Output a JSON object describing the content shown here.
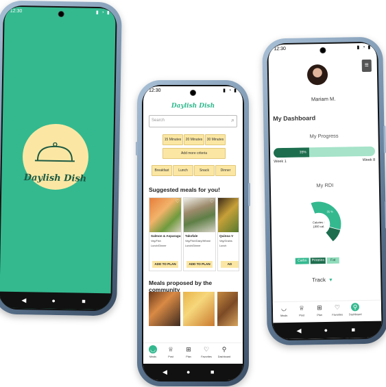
{
  "colors": {
    "brand_green": "#34b98f",
    "dark_green": "#1d6e4f",
    "light_yellow": "#fbe7a3"
  },
  "status_time": "12:30",
  "splash": {
    "logo_text": "Daylish Dish"
  },
  "home": {
    "brand": "Daylish Dish",
    "search_placeholder": "Search",
    "time_filters": [
      "15 Minutes",
      "20 Minutes",
      "30 Minutes"
    ],
    "add_criteria": "Add more criteria",
    "meal_filters": [
      "Breakfast",
      "Lunch",
      "Snack",
      "Dinner"
    ],
    "suggested_title": "Suggested meals for you!",
    "cards": [
      {
        "title": "Salmon & Asparagus",
        "tags": "Veg/Fish",
        "meals": "Lunch/Dinner",
        "action": "ADD TO PLAN"
      },
      {
        "title": "Takofale",
        "tags": "Veg/Fish/Dairy/Wheat",
        "meals": "Lunch/Dinner",
        "action": "ADD TO PLAN"
      },
      {
        "title": "Quinoa V",
        "tags": "Veg/Grains",
        "meals": "Lunch",
        "action": "AD"
      }
    ],
    "community_title": "Meals proposed by the community",
    "nav": [
      {
        "label": "Meals",
        "icon": "bowl-icon"
      },
      {
        "label": "Post",
        "icon": "chef-hat-icon"
      },
      {
        "label": "Plan",
        "icon": "plan-icon"
      },
      {
        "label": "Favorites",
        "icon": "heart-icon"
      },
      {
        "label": "Dashboard",
        "icon": "person-icon"
      }
    ]
  },
  "dashboard": {
    "user_name": "Mariam M.",
    "title": "My Dashboard",
    "progress_title": "My Progress",
    "progress_value": 0.35,
    "progress_label": "35%",
    "week_start": "Week 1",
    "week_end": "Week 8",
    "rdi_title": "My RDI",
    "calories": "Calories : 1800 cal.",
    "rdi": [
      {
        "name": "Carbs",
        "pct": 35,
        "label": "35 %",
        "color": "#34b98f"
      },
      {
        "name": "Proteins",
        "pct": 45,
        "label": "45 %",
        "color": "#1d6e4f"
      },
      {
        "name": "Fat",
        "pct": 20,
        "label": "20 %",
        "color": "#8fdcbb"
      }
    ],
    "track_label": "Track",
    "nav": [
      {
        "label": "Meals",
        "icon": "bowl-icon"
      },
      {
        "label": "Post",
        "icon": "chef-hat-icon"
      },
      {
        "label": "Plan",
        "icon": "plan-icon"
      },
      {
        "label": "Favorites",
        "icon": "heart-icon"
      },
      {
        "label": "Dashboard",
        "icon": "person-icon"
      }
    ]
  }
}
